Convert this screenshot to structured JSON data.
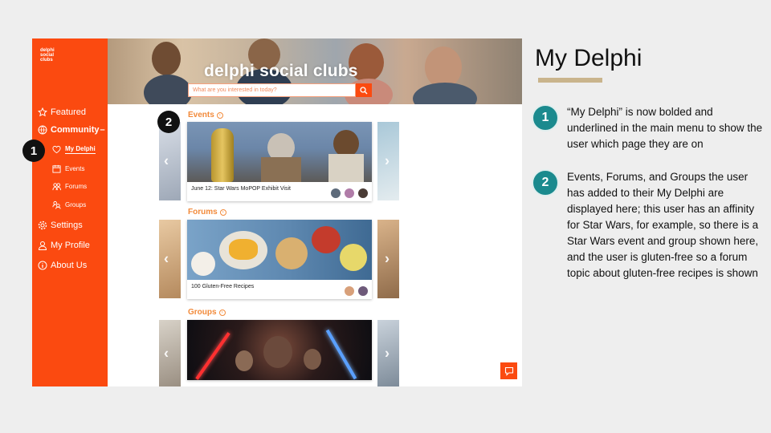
{
  "app": {
    "logo": [
      "delphi",
      "social",
      "clubs"
    ],
    "hero_title": "delphi social clubs",
    "search_placeholder": "What are you interested in today?",
    "nav": {
      "featured": "Featured",
      "community": "Community",
      "community_caret": "–",
      "my_delphi": "My Delphi",
      "events": "Events",
      "forums": "Forums",
      "groups": "Groups",
      "settings": "Settings",
      "my_profile": "My Profile",
      "about_us": "About Us"
    },
    "sections": {
      "events": {
        "title": "Events",
        "card_caption": "June 12: Star Wars MoPOP Exhibit Visit"
      },
      "forums": {
        "title": "Forums",
        "card_caption": "100 Gluten-Free Recipes"
      },
      "groups": {
        "title": "Groups",
        "card_caption": ""
      }
    },
    "plus_label": "+",
    "accent": "#fb4a10"
  },
  "callouts": {
    "one": "1",
    "two": "2"
  },
  "panel": {
    "title": "My Delphi",
    "notes": [
      {
        "num": "1",
        "text": "“My Delphi” is now bolded and underlined in the main menu to show the user which page they are on"
      },
      {
        "num": "2",
        "text": "Events, Forums, and Groups the user has added to their My Delphi are displayed here; this user has an affinity for Star Wars, for example, so there is a Star Wars event and group shown here, and the user is gluten-free so a forum topic about gluten-free recipes is shown"
      }
    ],
    "teal": "#1b8a8e"
  }
}
